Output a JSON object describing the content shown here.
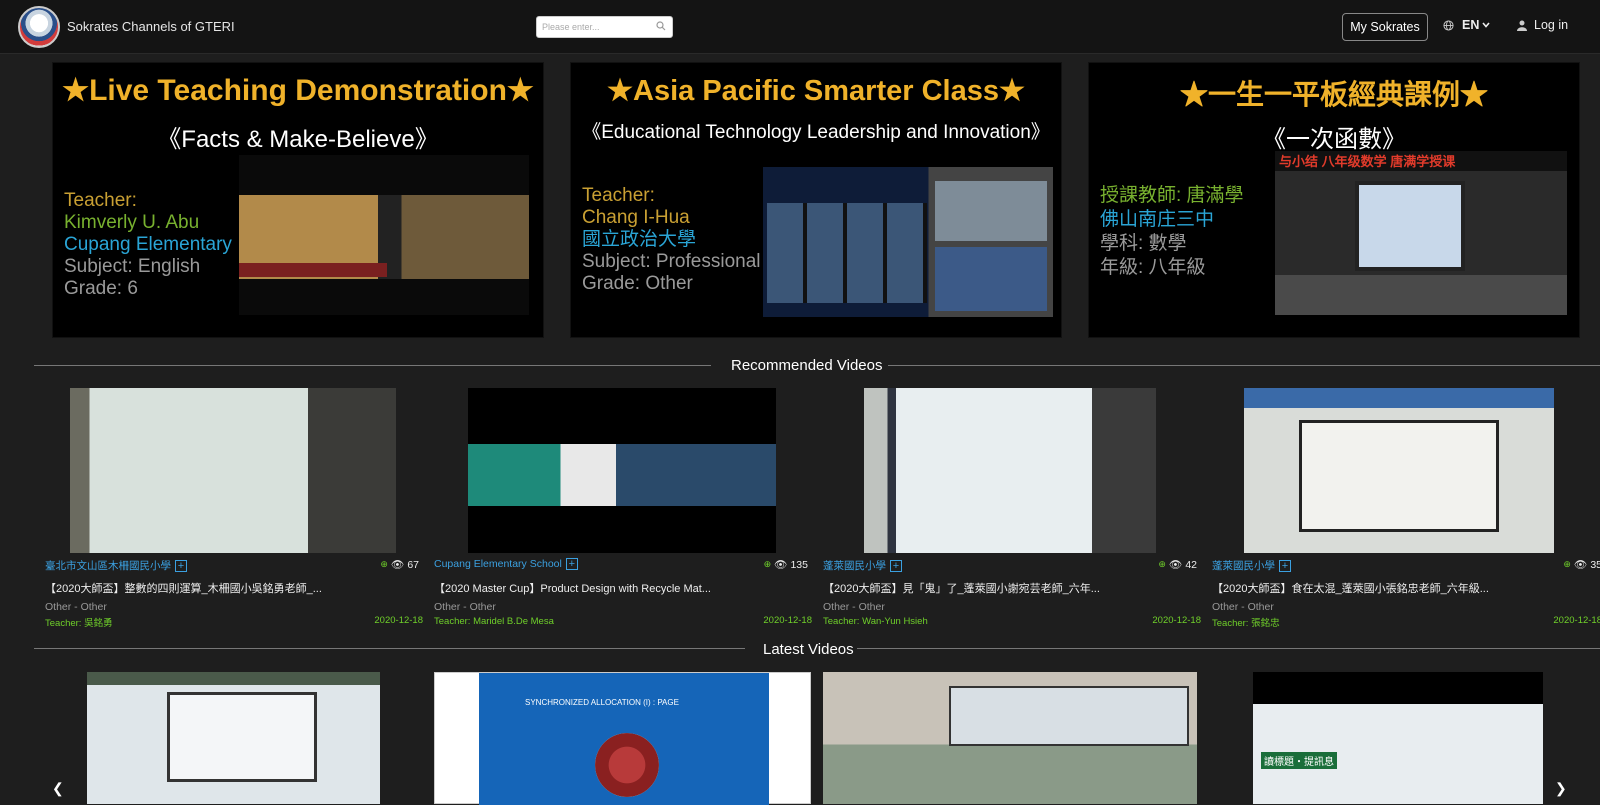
{
  "header": {
    "brand": "Sokrates Channels of GTERI",
    "search_placeholder": "Please enter...",
    "my_button": "My Sokrates",
    "lang": "EN",
    "login": "Log in"
  },
  "banners": [
    {
      "title": "★Live Teaching Demonstration★",
      "subtitle": "《Facts & Make-Believe》",
      "info": [
        "Teacher:",
        "Kimverly U. Abu",
        "Cupang Elementary",
        "Subject: English",
        "Grade: 6"
      ]
    },
    {
      "title": "★Asia Pacific Smarter Class★",
      "subtitle": "《Educational Technology Leadership and Innovation》",
      "info": [
        "Teacher:",
        "Chang I-Hua",
        "國立政治大學",
        "Subject: Professional",
        "Grade: Other"
      ]
    },
    {
      "title": "★一生一平板經典課例★",
      "subtitle": "《一次函數》",
      "info": [
        "授課教師: 唐滿學",
        "佛山南庄三中",
        "學科: 數學",
        "年級: 八年級"
      ],
      "caption": "与小结  八年级数学 唐满学授课"
    }
  ],
  "recommended": {
    "heading": "Recommended Videos",
    "videos": [
      {
        "school": "臺北市文山區木柵國民小學",
        "views": "67",
        "title": "【2020大師盃】整數的四則運算_木柵國小吳銘勇老師_...",
        "category": "Other - Other",
        "teacher": "Teacher: 吳銘勇",
        "date": "2020-12-18"
      },
      {
        "school": "Cupang Elementary School",
        "views": "135",
        "title": "【2020 Master Cup】Product Design with Recycle Mat...",
        "category": "Other - Other",
        "teacher": "Teacher: Maridel B.De Mesa",
        "date": "2020-12-18"
      },
      {
        "school": "蓬萊國民小學",
        "views": "42",
        "title": "【2020大師盃】見「鬼」了_蓬萊國小謝宛芸老師_六年...",
        "category": "Other - Other",
        "teacher": "Teacher: Wan-Yun Hsieh",
        "date": "2020-12-18"
      },
      {
        "school": "蓬萊國民小學",
        "views": "35",
        "title": "【2020大師盃】食在太混_蓬萊國小張銘忠老師_六年級...",
        "category": "Other - Other",
        "teacher": "Teacher: 張銘忠",
        "date": "2020-12-18"
      }
    ]
  },
  "latest": {
    "heading": "Latest Videos",
    "thumbs_text": [
      "",
      "SYNCHRONIZED ALLOCATION (I) : PAGE",
      "",
      "讀標題・提訊息"
    ]
  },
  "colors": {
    "accent_gold": "#f0b22a",
    "link_blue": "#3ba0e0",
    "teacher_green": "#6fcf2a"
  }
}
